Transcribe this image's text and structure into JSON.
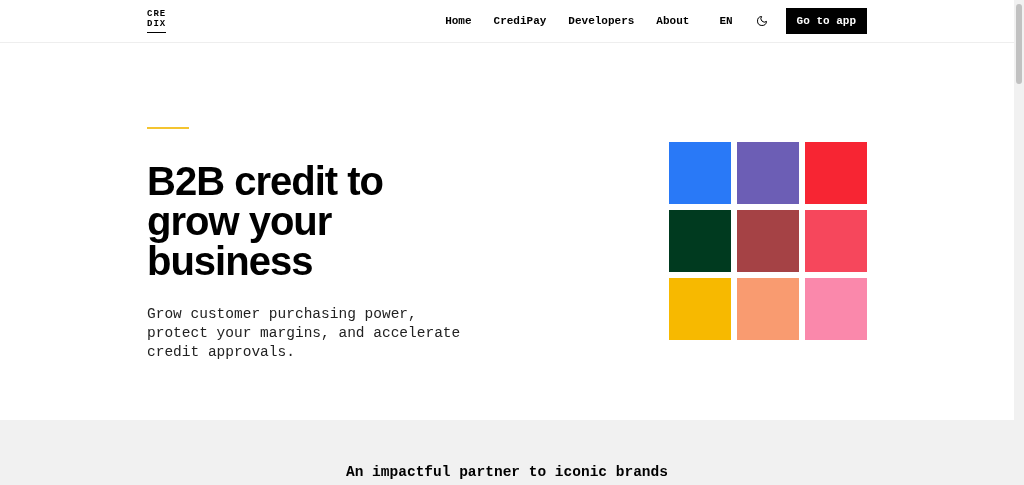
{
  "logo": {
    "lines": [
      "CRE",
      "DIX"
    ]
  },
  "nav": {
    "links": [
      "Home",
      "CrediPay",
      "Developers",
      "About"
    ],
    "language": "EN",
    "cta": "Go to app"
  },
  "hero": {
    "heading": "B2B credit to grow your business",
    "subheading": "Grow customer purchasing power, protect your margins, and accelerate credit approvals.",
    "tiles": [
      {
        "color": "#2979f7"
      },
      {
        "color": "#6c5eb5"
      },
      {
        "color": "#f72533"
      },
      {
        "color": "#003a1f"
      },
      {
        "color": "#a54245"
      },
      {
        "color": "#f6475c"
      },
      {
        "color": "#f7b900"
      },
      {
        "color": "#f99b70"
      },
      {
        "color": "#fa88ab"
      }
    ]
  },
  "partners": {
    "title": "An impactful partner to iconic brands"
  }
}
